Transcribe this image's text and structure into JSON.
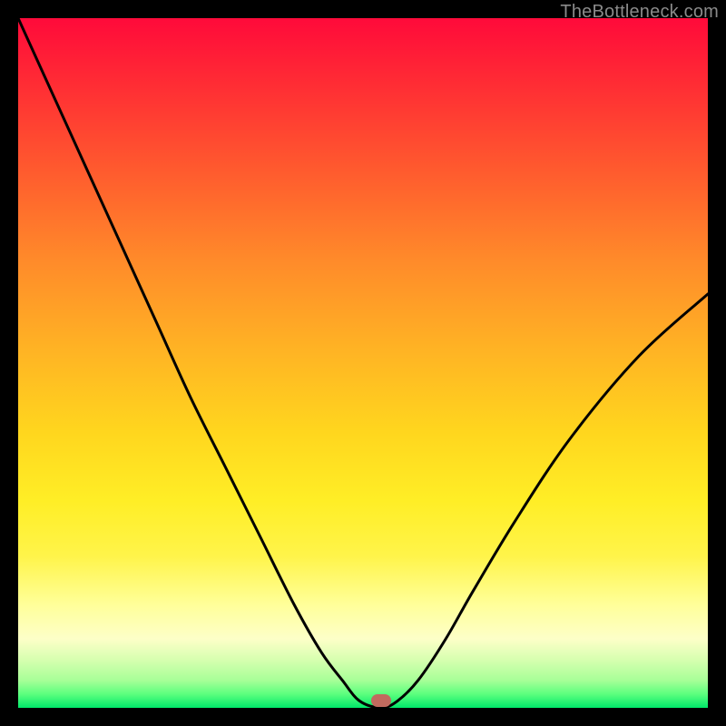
{
  "watermark": {
    "text": "TheBottleneck.com"
  },
  "marker": {
    "x_pct": 52.6,
    "y_pct": 99.0,
    "color": "#c16a5e"
  },
  "chart_data": {
    "type": "line",
    "title": "",
    "xlabel": "",
    "ylabel": "",
    "xlim": [
      0,
      100
    ],
    "ylim": [
      0,
      100
    ],
    "grid": false,
    "legend": false,
    "annotations": [
      "TheBottleneck.com"
    ],
    "series": [
      {
        "name": "bottleneck-curve",
        "x": [
          0,
          5,
          10,
          15,
          20,
          25,
          30,
          35,
          40,
          44,
          47,
          49.5,
          52.6,
          55,
          58,
          62,
          66,
          72,
          80,
          90,
          100
        ],
        "y": [
          100,
          89,
          78,
          67,
          56,
          45,
          35,
          25,
          15,
          8,
          4,
          1,
          0,
          1,
          4,
          10,
          17,
          27,
          39,
          51,
          60
        ]
      }
    ],
    "marker": {
      "x": 52.6,
      "y": 0
    }
  }
}
